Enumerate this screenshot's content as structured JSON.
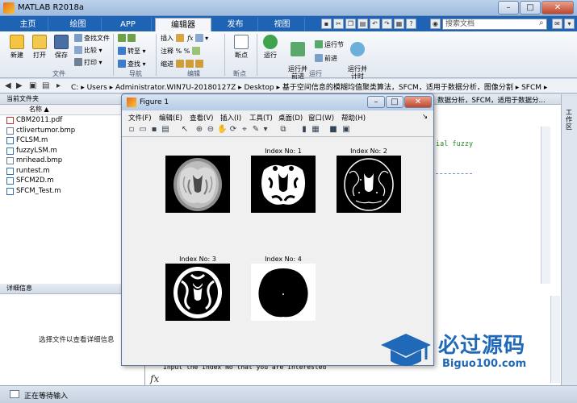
{
  "window": {
    "title": "MATLAB R2018a"
  },
  "tabs": [
    "主页",
    "绘图",
    "APP",
    "编辑器",
    "发布",
    "视图"
  ],
  "active_tab": "编辑器",
  "search": {
    "placeholder": "搜索文档"
  },
  "ribbon": {
    "file_group": {
      "label": "文件",
      "new": "新建",
      "open": "打开",
      "save": "保存",
      "find_files": "查找文件",
      "compare": "比较",
      "print": "打印"
    },
    "nav_group": {
      "label": "导航",
      "goto": "转至",
      "find": "查找"
    },
    "edit_group": {
      "label": "编辑",
      "insert": "插入",
      "comment": "注释",
      "indent": "缩进"
    },
    "breakpoint_group": {
      "label": "断点",
      "breakpoints": "断点"
    },
    "run_group": {
      "label": "运行",
      "run": "运行",
      "run_advance": "运行并\n前进",
      "run_section": "运行节",
      "advance": "前进",
      "run_time": "运行并\n计时"
    }
  },
  "address": {
    "segments": [
      "C:",
      "Users",
      "Administrator.WIN7U-20180127Z",
      "Desktop",
      "基于空间信息的模糊均值聚类算法，SFCM，适用于数据分析，图像分割",
      "SFCM"
    ]
  },
  "left_pane": {
    "header": "当前文件夹",
    "column": "名称 ▲",
    "files": [
      "CBM2011.pdf",
      "ctlivertumor.bmp",
      "FCLSM.m",
      "fuzzyLSM.m",
      "mrihead.bmp",
      "runtest.m",
      "SFCM2D.m",
      "SFCM_Test.m"
    ],
    "detail_header": "详细信息",
    "detail_hint": "选择文件以查看详细信息"
  },
  "behind": {
    "path_tail": "数据分析，SFCM，适用于数据分...",
    "code_fragment": "ial fuzzy",
    "workspace_label": "工作区"
  },
  "command": {
    "prompt_text": "Input the index No that you are interested",
    "fx": "fx"
  },
  "status": {
    "text": "正在等待输入"
  },
  "figure": {
    "title": "Figure 1",
    "menu": [
      "文件(F)",
      "编辑(E)",
      "查看(V)",
      "插入(I)",
      "工具(T)",
      "桌面(D)",
      "窗口(W)",
      "帮助(H)"
    ],
    "panels": [
      {
        "title": ""
      },
      {
        "title": "Index No: 1"
      },
      {
        "title": "Index No: 2"
      },
      {
        "title": "Index No: 3"
      },
      {
        "title": "Index No: 4"
      }
    ]
  },
  "watermark": {
    "zh": "必过源码",
    "en": "Biguo100.com"
  },
  "colors": {
    "tabbar": "#1f63b4",
    "watermark": "#1f69b8"
  }
}
